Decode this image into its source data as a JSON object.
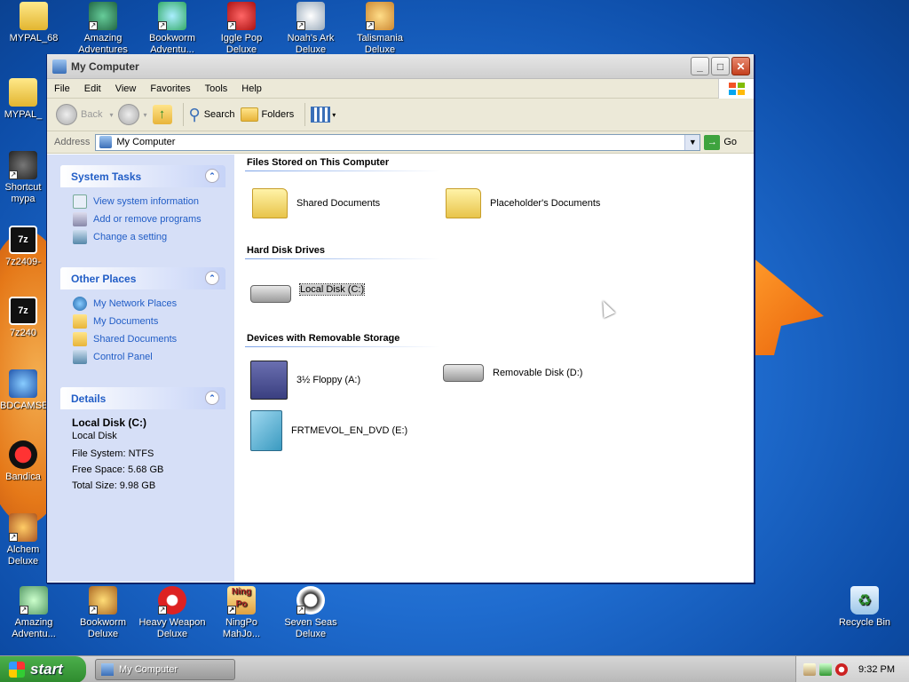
{
  "desktop": {
    "icons_top": [
      {
        "label": "MYPAL_68",
        "name": "mypal-icon"
      },
      {
        "label": "Amazing Adventures",
        "name": "amazing-adventures-icon"
      },
      {
        "label": "Bookworm Adventu...",
        "name": "bookworm-adventures-icon"
      },
      {
        "label": "Iggle Pop Deluxe",
        "name": "iggle-pop-icon"
      },
      {
        "label": "Noah's Ark Deluxe",
        "name": "noahs-ark-icon"
      },
      {
        "label": "Talismania Deluxe",
        "name": "talismania-icon"
      }
    ],
    "icons_left": [
      {
        "label": "MYPAL_",
        "name": "mypal-folder-icon"
      },
      {
        "label": "Shortcut mypa",
        "name": "shortcut-mypal-icon"
      },
      {
        "label": "7z2409-",
        "name": "7zip-icon"
      },
      {
        "label": "7z240",
        "name": "7zip-2-icon"
      },
      {
        "label": "BDCAMSE",
        "name": "bdcam-icon"
      },
      {
        "label": "Bandica",
        "name": "bandicam-icon"
      },
      {
        "label": "Alchem Deluxe",
        "name": "alchemy-icon"
      }
    ],
    "icons_bottom": [
      {
        "label": "Amazing Adventu...",
        "name": "amazing-adventures-2-icon"
      },
      {
        "label": "Bookworm Deluxe",
        "name": "bookworm-deluxe-icon"
      },
      {
        "label": "Heavy Weapon Deluxe",
        "name": "heavy-weapon-icon"
      },
      {
        "label": "NingPo MahJo...",
        "name": "ningpo-icon"
      },
      {
        "label": "Seven Seas Deluxe",
        "name": "seven-seas-icon"
      }
    ],
    "recycle_bin": "Recycle Bin"
  },
  "window": {
    "title": "My Computer",
    "menu": [
      "File",
      "Edit",
      "View",
      "Favorites",
      "Tools",
      "Help"
    ],
    "toolbar": {
      "back": "Back",
      "search": "Search",
      "folders": "Folders"
    },
    "address": {
      "label": "Address",
      "value": "My Computer",
      "go": "Go"
    },
    "sidebar": {
      "system_tasks": {
        "title": "System Tasks",
        "items": [
          "View system information",
          "Add or remove programs",
          "Change a setting"
        ]
      },
      "other_places": {
        "title": "Other Places",
        "items": [
          "My Network Places",
          "My Documents",
          "Shared Documents",
          "Control Panel"
        ]
      },
      "details": {
        "title": "Details",
        "name": "Local Disk (C:)",
        "type": "Local Disk",
        "fs": "File System: NTFS",
        "free": "Free Space: 5.68 GB",
        "total": "Total Size: 9.98 GB"
      }
    },
    "content": {
      "files_header": "Files Stored on This Computer",
      "shared_docs": "Shared Documents",
      "placeholder_docs": "Placeholder's Documents",
      "hdd_header": "Hard Disk Drives",
      "local_disk": "Local Disk (C:)",
      "removable_header": "Devices with Removable Storage",
      "floppy": "3½ Floppy (A:)",
      "removable": "Removable Disk (D:)",
      "dvd": "FRTMEVOL_EN_DVD (E:)"
    }
  },
  "taskbar": {
    "start": "start",
    "task": "My Computer",
    "clock": "9:32 PM"
  },
  "colors": {
    "accent": "#215dc6",
    "desktop": "#1f6ccf",
    "start_green": "#3a9a3a"
  }
}
